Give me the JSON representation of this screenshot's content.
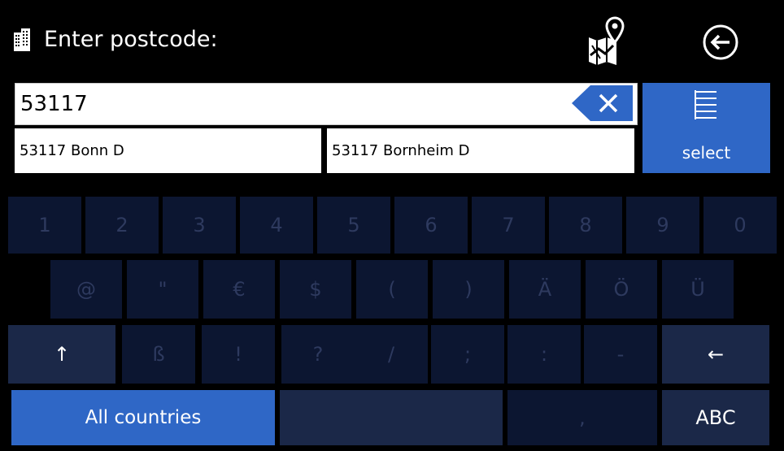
{
  "header": {
    "title": "Enter postcode:",
    "title_icon": "building-icon",
    "map_button_icon": "map-pin-icon",
    "back_button_icon": "back-arrow-icon"
  },
  "postcode_input": {
    "value": "53117",
    "clear_icon": "clear-x-icon"
  },
  "suggestions": [
    {
      "label": "53117 Bonn  D"
    },
    {
      "label": "53117 Bornheim  D"
    }
  ],
  "select_button": {
    "label": "select",
    "icon": "list-icon"
  },
  "keyboard": {
    "row1": [
      "1",
      "2",
      "3",
      "4",
      "5",
      "6",
      "7",
      "8",
      "9",
      "0"
    ],
    "row2": [
      "@",
      "\"",
      "€",
      "$",
      "(",
      ")",
      "Ä",
      "Ö",
      "Ü"
    ],
    "row3": [
      "↑",
      "ß",
      "!",
      "?",
      "/",
      ";",
      ":",
      "-",
      "←"
    ],
    "row4": {
      "all_countries": "All countries",
      "space": "",
      "comma": ",",
      "abc": "ABC"
    }
  },
  "colors": {
    "background": "#000000",
    "accent_blue": "#2f67c6",
    "key_disabled": "#0c1631",
    "key_disabled_text": "#2e3a5f",
    "key_active": "#1b2848"
  }
}
